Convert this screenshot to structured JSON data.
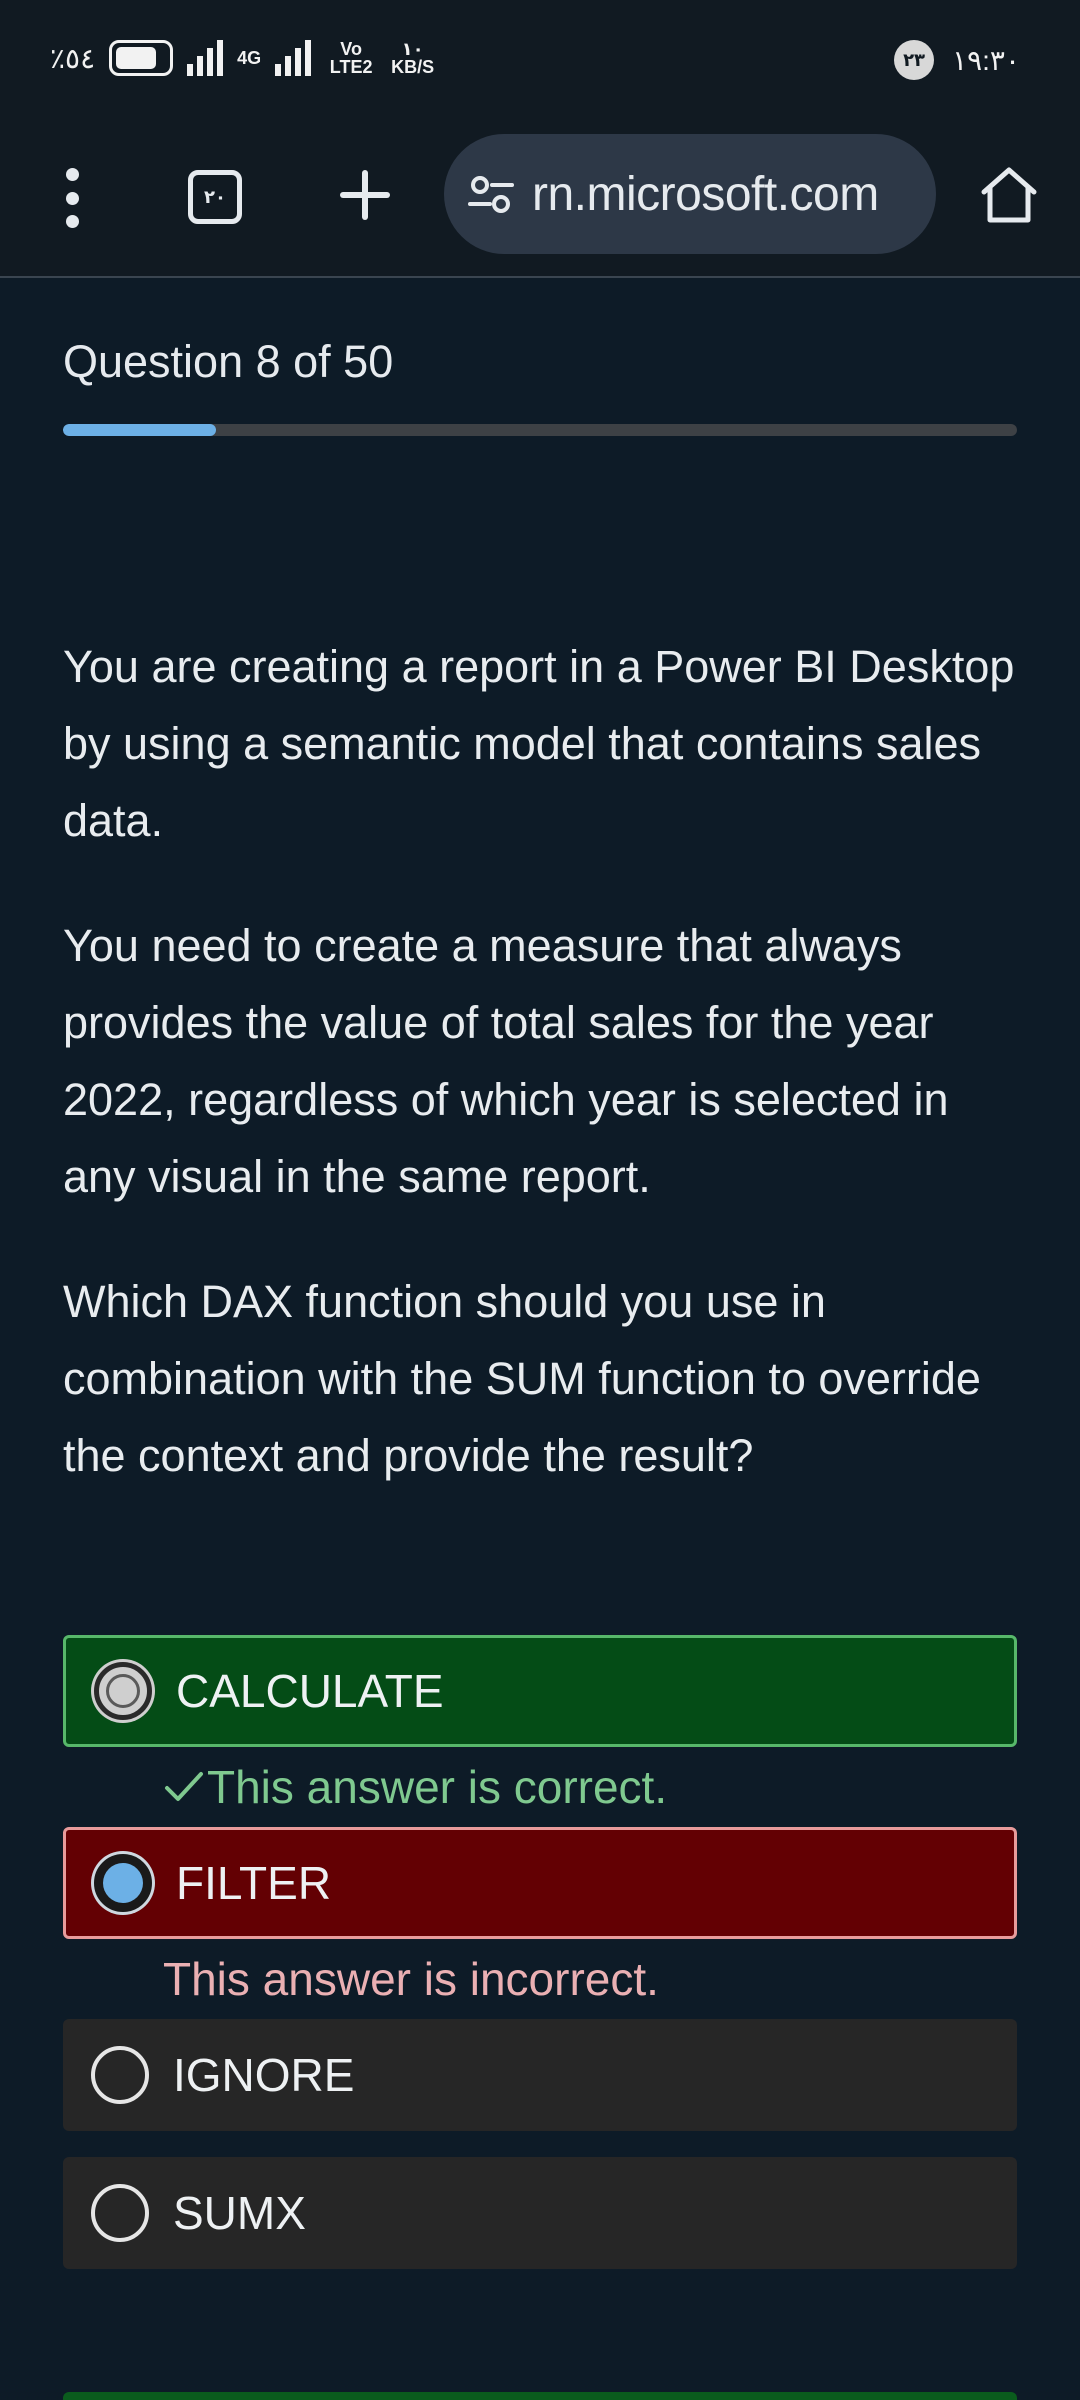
{
  "status_bar": {
    "battery_percent": "٪٥٤",
    "network_type": "4G",
    "volte_label": "Vo LTE2",
    "speed_value": "١٠",
    "speed_unit": "KB/S",
    "notification_count": "٢٣",
    "time": "١٩:٣٠"
  },
  "browser": {
    "menu_icon": "kebab-menu-icon",
    "tab_count": "٢٠",
    "url": "rn.microsoft.com",
    "site_settings_icon": "tune-icon",
    "home_icon": "home-icon"
  },
  "quiz": {
    "counter": "Question 8 of 50",
    "progress_fraction": 0.16,
    "question_paragraphs": [
      "You are creating a report in a Power BI Desktop by using a semantic model that contains sales data.",
      "You need to create a measure that always provides the value of total sales for the year 2022, regardless of which year is selected in any visual in the same report.",
      "Which DAX function should you use in combination with the SUM function to override the context and provide the result?"
    ],
    "options": [
      {
        "label": "CALCULATE",
        "state": "correct",
        "feedback": "This answer is correct."
      },
      {
        "label": "FILTER",
        "state": "incorrect",
        "feedback": "This answer is incorrect."
      },
      {
        "label": "IGNORE",
        "state": "neutral"
      },
      {
        "label": "SUMX",
        "state": "neutral"
      }
    ]
  },
  "colors": {
    "background": "#0d1b27",
    "correct_bg": "#044c16",
    "incorrect_bg": "#630003",
    "neutral_bg": "#262626",
    "progress_fill": "#6cb0e6",
    "correct_text": "#7fc98f",
    "incorrect_text": "#eab0b3"
  }
}
